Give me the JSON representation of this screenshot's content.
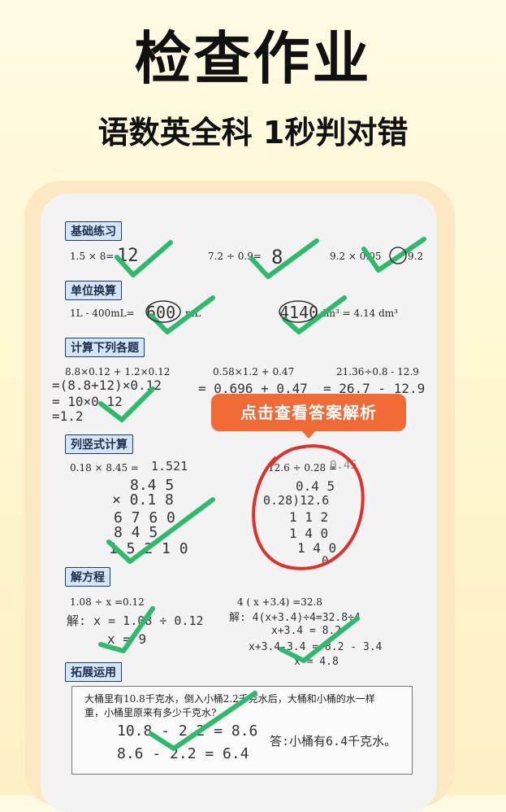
{
  "header": {
    "title": "检查作业",
    "subtitle": "语数英全科 1秒判对错"
  },
  "sections": {
    "basic": {
      "label": "基础练习",
      "items": [
        {
          "question": "1.5 × 8=",
          "answer": "12"
        },
        {
          "question": "7.2 ÷ 0.9=",
          "answer": "8"
        },
        {
          "question": "9.2 × 0.05",
          "answer": "9.2"
        }
      ]
    },
    "units": {
      "label": "单位换算",
      "left_before": "1L - 400mL=",
      "left_answer": "600",
      "left_unit": "mL",
      "right_answer": "4140",
      "right_after": "dm³ = 4.14 dm³"
    },
    "calc": {
      "label": "计算下列各题",
      "problems": [
        "8.8×0.12 + 1.2×0.12",
        "0.58×1.2 + 0.47",
        "21.36÷0.8 - 12.9"
      ],
      "work1": [
        "=(8.8+12)×0.12",
        "= 10×0.12",
        "=1.2"
      ],
      "work2": "= 0.696 + 0.47",
      "work3": "= 26.7 - 12.9"
    },
    "vertical": {
      "label": "列竖式计算",
      "left_question": "0.18 × 8.45 =",
      "left_answer": "1.521",
      "left_work": [
        "8.4 5",
        "× 0.1 8",
        "6 7 6 0",
        "8 4 5",
        "1.5 2 1 0"
      ],
      "right_question": "12.6 ÷ 0.28 =",
      "right_answer": "0.45",
      "right_work": [
        "0.4 5",
        "0.28)12.6",
        "1 1 2",
        "1 4 0",
        "1 4 0",
        "0"
      ]
    },
    "equation": {
      "label": "解方程",
      "left_question": "1.08 ÷ x =0.12",
      "left_work": [
        "解:  x = 1.08 ÷ 0.12",
        "x = 9"
      ],
      "right_question": "4 ( x +3.4) =32.8",
      "right_work": [
        "解: 4(x+3.4)÷4=32.8÷4",
        "x+3.4 = 8.2",
        "x+3.4-3.4 = 8.2 - 3.4",
        "x = 4.8"
      ]
    },
    "extend": {
      "label": "拓展运用",
      "problem_text_1": "大桶里有10.8千克水，倒入小桶2.2千克水后，大桶和小桶的水一样",
      "problem_text_2": "重，小桶里原来有多少千克水?",
      "work": [
        "10.8 - 2.2 = 8.6",
        "8.6 - 2.2 = 6.4"
      ],
      "answer": "答:小桶有6.4千克水。"
    }
  },
  "tooltip": {
    "label": "点击查看答案解析"
  },
  "colors": {
    "check": "#2dba6a",
    "circle": "#e0302a",
    "tooltip": "#f06a36",
    "label_bg": "#d3e6f5"
  }
}
